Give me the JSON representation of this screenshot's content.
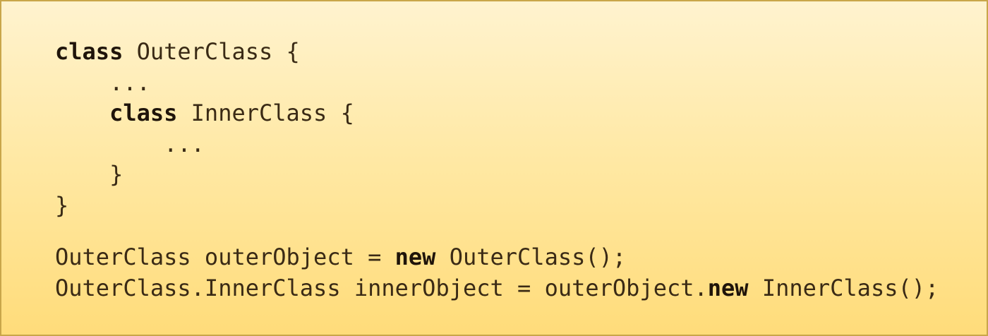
{
  "code": {
    "lines": [
      {
        "kw": "class",
        "text": " OuterClass {"
      },
      {
        "indent": "    ",
        "text": "..."
      },
      {
        "indent": "    ",
        "kw": "class",
        "text": " InnerClass {"
      },
      {
        "indent": "        ",
        "text": "..."
      },
      {
        "indent": "    ",
        "text": "}"
      },
      {
        "text": "}"
      },
      {
        "text": "OuterClass outerObject = ",
        "kw": "new",
        "text2": " OuterClass();"
      },
      {
        "text": "OuterClass.InnerClass innerObject = outerObject.",
        "kw": "new",
        "text2": " InnerClass();"
      }
    ]
  }
}
